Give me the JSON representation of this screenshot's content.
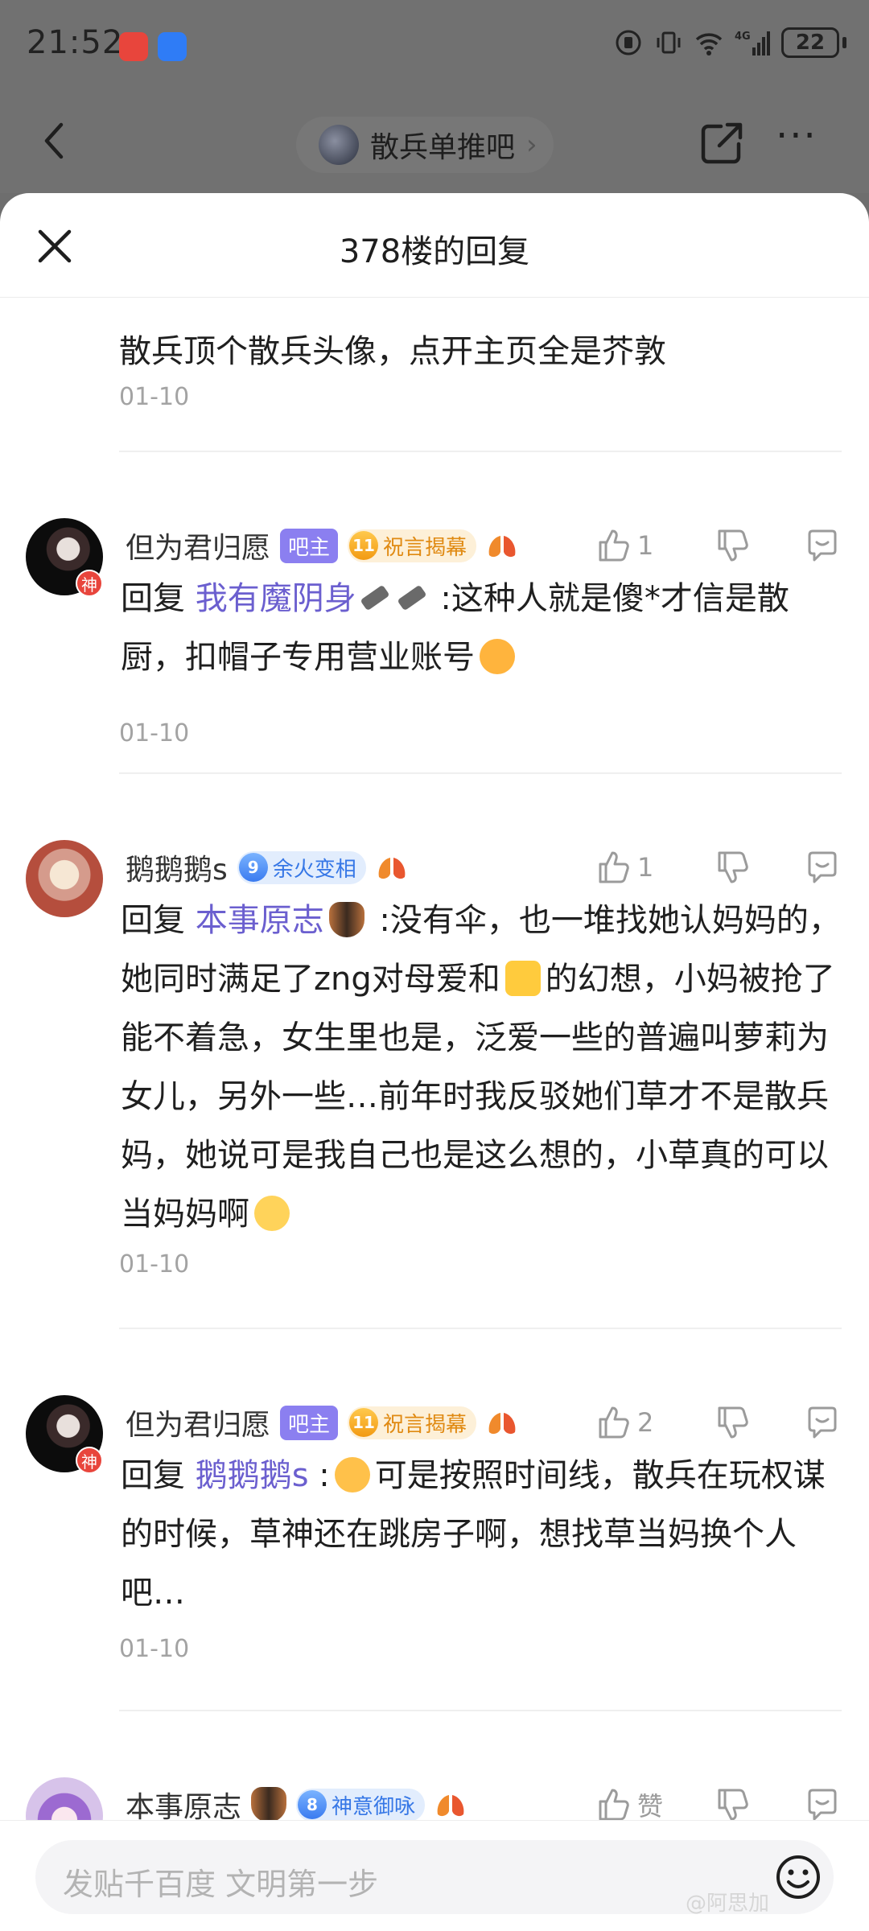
{
  "status_bar": {
    "time": "21:52",
    "battery": "22",
    "network": "4G"
  },
  "app_bar": {
    "forum_name": "散兵单推吧",
    "chevron": "›"
  },
  "sheet": {
    "title": "378楼的回复"
  },
  "first_reply": {
    "text": "散兵顶个散兵头像，点开主页全是芥敦",
    "date": "01-10"
  },
  "replies": [
    {
      "username": "但为君归愿",
      "owner_tag": "吧主",
      "level": "11",
      "level_title": "祝言揭幕",
      "likes": "1",
      "reply_prefix": "回复 ",
      "reply_to": "我有魔阴身",
      "text": " :这种人就是傻*才信是散厨，扣帽子专用营业账号",
      "date": "01-10",
      "god_badge": "神"
    },
    {
      "username": "鹅鹅鹅s",
      "level": "9",
      "level_title": "余火变相",
      "likes": "1",
      "reply_prefix": "回复 ",
      "reply_to": "本事原志",
      "text_a": " :没有伞，也一堆找她认妈妈的，她同时满足了zng对母爱和",
      "text_b": "的幻想，小妈被抢了能不着急，女生里也是，泛爱一些的普遍叫萝莉为女儿，另外一些…前年时我反驳她们草才不是散兵妈，她说可是我自己也是这么想的，小草真的可以当妈妈啊",
      "date": "01-10"
    },
    {
      "username": "但为君归愿",
      "owner_tag": "吧主",
      "level": "11",
      "level_title": "祝言揭幕",
      "likes": "2",
      "reply_prefix": "回复 ",
      "reply_to": "鹅鹅鹅s",
      "text": "可是按照时间线，散兵在玩权谋的时候，草神还在跳房子啊，想找草当妈换个人吧…",
      "separator": " :",
      "date": "01-10",
      "god_badge": "神"
    },
    {
      "username": "本事原志",
      "level": "8",
      "level_title": "神意御咏",
      "likes": "赞"
    }
  ],
  "bottom_bar": {
    "placeholder": "发贴千百度 文明第一步",
    "watermark": "@阿思加"
  },
  "colors": {
    "accent": "#6b5fcf",
    "owner_tag": "#8b7ff0",
    "gold_level": "#f29a13",
    "blue_level": "#3a7bf0"
  }
}
